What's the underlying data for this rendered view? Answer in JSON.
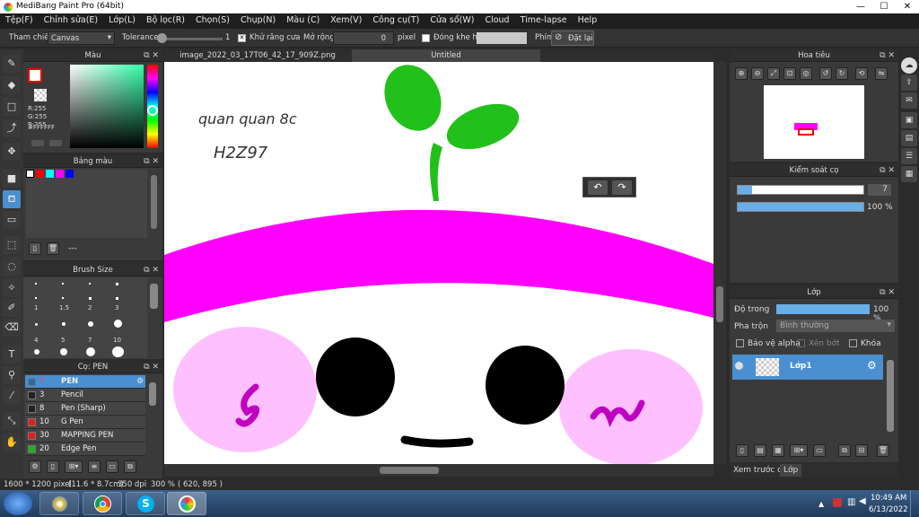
{
  "window": {
    "title": "MediBang Paint Pro (64bit)",
    "minimize": "—",
    "maximize": "☐",
    "close": "✕"
  },
  "menu": [
    "Tệp(F)",
    "Chỉnh sửa(E)",
    "Lớp(L)",
    "Bộ lọc(R)",
    "Chọn(S)",
    "Chụp(N)",
    "Màu (C)",
    "Xem(V)",
    "Công cụ(T)",
    "Cửa sổ(W)",
    "Cloud",
    "Time-lapse",
    "Help"
  ],
  "toolbar": {
    "reference_label": "Tham chiếu",
    "reference_value": "Canvas",
    "tolerance_label": "Tolerance",
    "tolerance_value": "1",
    "antialias_label": "Khử răng cưa",
    "expand_label": "Mở rộng",
    "expand_value": "0",
    "expand_unit": "pixel",
    "close_gap_label": "Đóng khe hở",
    "key_label": "Phím",
    "reset_label": "Đặt lại"
  },
  "color_panel": {
    "title": "Màu",
    "rgb_r": "R:255",
    "rgb_g": "G:255",
    "rgb_b": "B:255",
    "hex": "#FFFFFF"
  },
  "palette_panel": {
    "title": "Bảng màu",
    "swatches": [
      "#ffffff",
      "#ff0000",
      "#00ffff",
      "#ff00ff",
      "#0000ff"
    ],
    "footer_text": "---"
  },
  "brush_size_panel": {
    "title": "Brush Size",
    "sizes": [
      "1",
      "1.5",
      "2",
      "3",
      "4",
      "5",
      "7",
      "10"
    ]
  },
  "brush_panel": {
    "title": "Cọ: PEN",
    "brushes": [
      {
        "size": "7",
        "name": "PEN",
        "color": "#ffffff"
      },
      {
        "size": "3",
        "name": "Pencil",
        "color": "#222222"
      },
      {
        "size": "8",
        "name": "Pen (Sharp)",
        "color": "#222222"
      },
      {
        "size": "10",
        "name": "G Pen",
        "color": "#e02020"
      },
      {
        "size": "30",
        "name": "MAPPING PEN",
        "color": "#e02020"
      },
      {
        "size": "20",
        "name": "Edge Pen",
        "color": "#20b020"
      }
    ]
  },
  "tabs": {
    "file_tab": "image_2022_03_17T06_42_17_909Z.png",
    "active_tab": "Untitled"
  },
  "canvas": {
    "handwriting_1": "quan quan 8c",
    "handwriting_2": "H2Z97",
    "colors": {
      "pink_band": "#ff00ff",
      "sprout": "#22c01a",
      "cheek": "#ffc0ff",
      "swirl": "#c000c0",
      "eye": "#000000"
    }
  },
  "navigator_panel": {
    "title": "Hoa tiêu"
  },
  "brush_control_panel": {
    "title": "Kiểm soát cọ",
    "size_value": "7",
    "opacity_value": "100 %"
  },
  "layer_panel": {
    "title": "Lớp",
    "opacity_label": "Độ trong",
    "opacity_value": "100 %",
    "blend_label": "Pha trộn",
    "blend_value": "Bình thường",
    "protect_alpha": "Bảo vệ alpha",
    "clipping": "Xén bớt",
    "lock": "Khóa",
    "layer_name": "Lớp1"
  },
  "bottom_tabs": {
    "preview": "Xem trước cọ",
    "layer": "Lớp"
  },
  "status": {
    "dimensions": "1600 * 1200 pixel",
    "physical": "(11.6 * 8.7cm)",
    "dpi": "350 dpi",
    "zoom": "300 %",
    "coords": "( 620, 895 )"
  },
  "taskbar": {
    "time": "10:49 AM",
    "date": "6/13/2022"
  }
}
